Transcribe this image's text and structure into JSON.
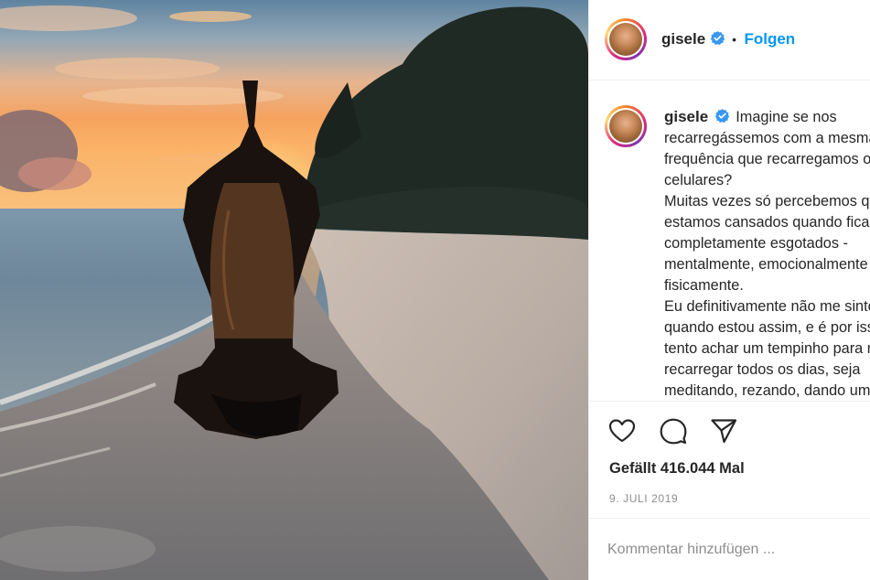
{
  "post": {
    "image_alt": "Woman sitting on a beach at sunset with hands raised above her head",
    "author": {
      "username": "gisele",
      "verified": true,
      "avatar_icon": "profile-avatar"
    },
    "header": {
      "separator": "•",
      "follow_label": "Folgen"
    },
    "caption": {
      "lines": [
        "Imagine se nos",
        "recarregássemos com a mesma",
        "frequência que recarregamos os",
        "celulares?",
        "Muitas vezes só percebemos que",
        "estamos cansados quando ficamos",
        "completamente esgotados -",
        "mentalmente, emocionalmente e",
        "fisicamente.",
        "Eu definitivamente não me sinto bem",
        "quando estou assim, e é por isso que",
        "tento achar um tempinho para me",
        "recarregar todos os dias, seja",
        "meditando, rezando, dando uma"
      ]
    },
    "actions": {
      "like_icon": "heart-icon",
      "comment_icon": "comment-icon",
      "share_icon": "paper-plane-icon"
    },
    "likes_text": "Gefällt 416.044 Mal",
    "date_text": "9. JULI 2019",
    "comment_placeholder": "Kommentar hinzufügen ..."
  },
  "colors": {
    "follow_blue": "#0095f6",
    "verified_blue": "#3897f0",
    "text": "#262626",
    "muted": "#8e8e8e",
    "divider": "#efefef"
  }
}
